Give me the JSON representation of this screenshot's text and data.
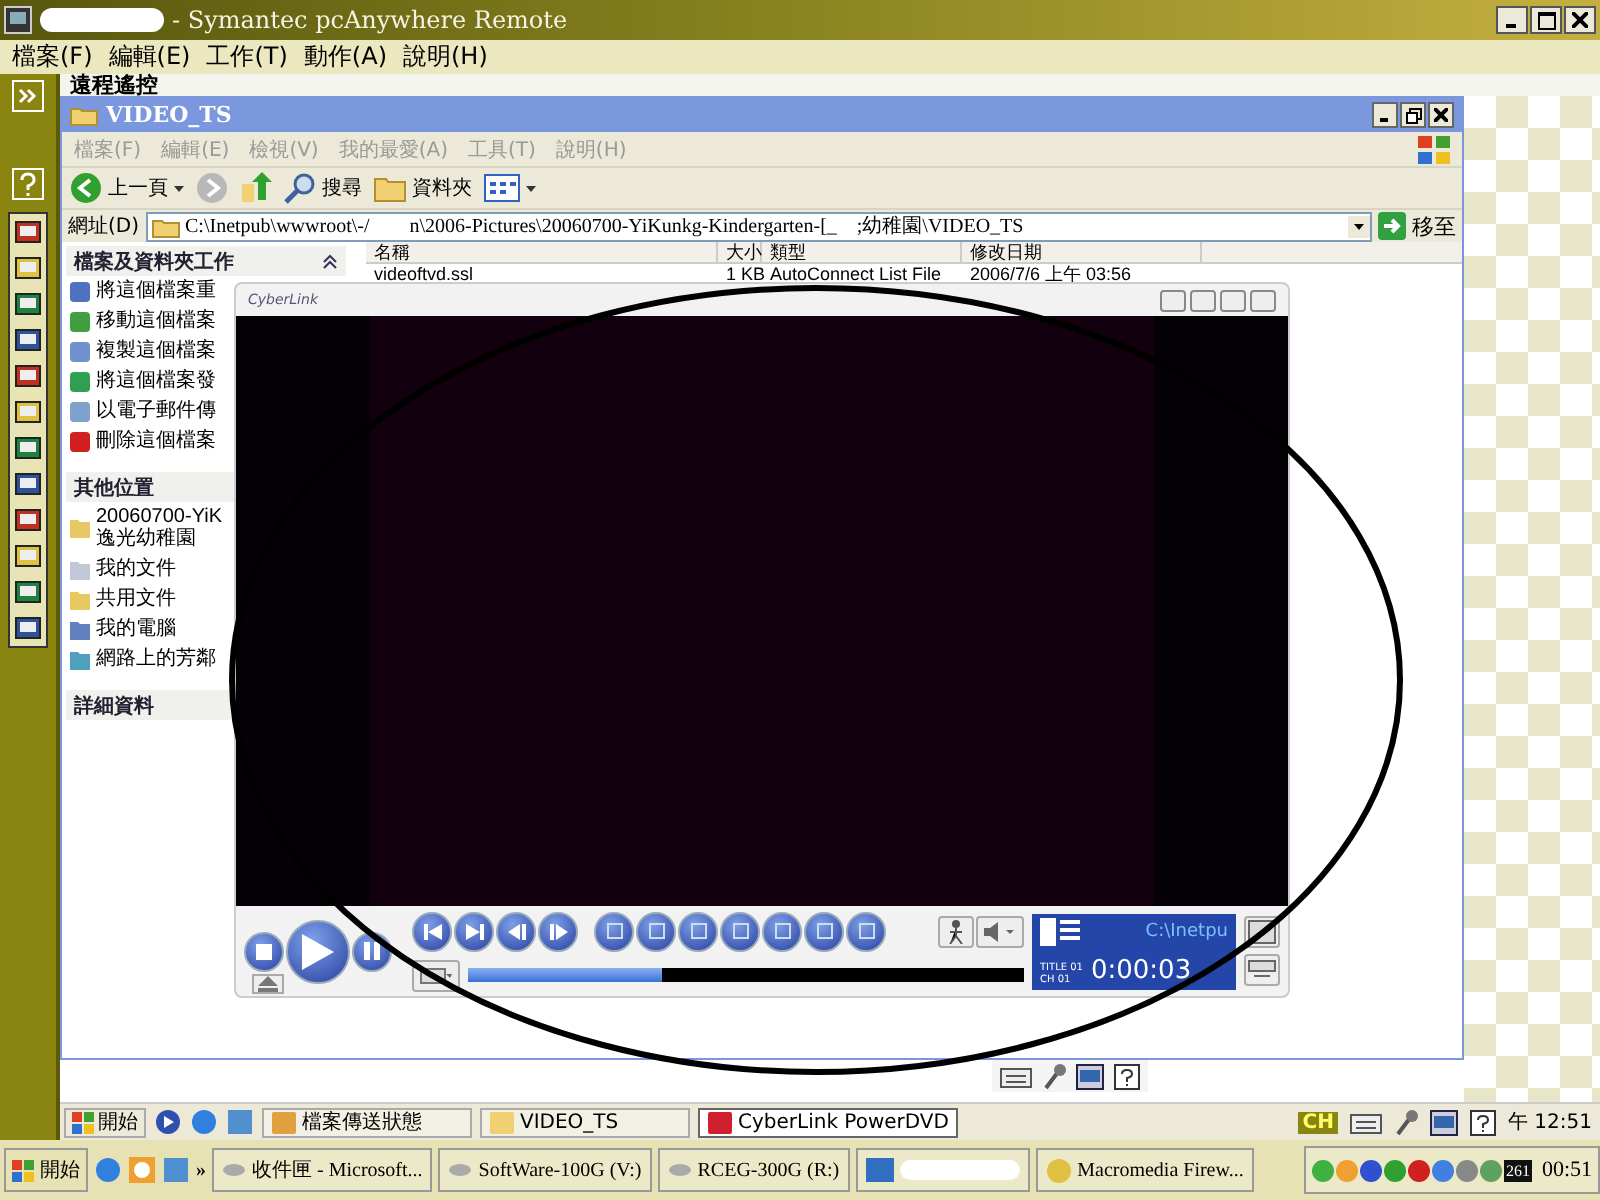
{
  "window": {
    "title": "- Symantec pcAnywhere Remote"
  },
  "menu": [
    "檔案(F)",
    "編輯(E)",
    "工作(T)",
    "動作(A)",
    "說明(H)"
  ],
  "remote_header": "遠程遙控",
  "explorer": {
    "title": "VIDEO_TS",
    "menu": [
      "檔案(F)",
      "編輯(E)",
      "檢視(V)",
      "我的最愛(A)",
      "工具(T)",
      "說明(H)"
    ],
    "toolbar": [
      "上一頁",
      "搜尋",
      "資料夾"
    ],
    "address_label": "網址(D)",
    "address": "C:\\Inetpub\\wwwroot\\-/        n\\2006-Pictures\\20060700-YiKunkg-Kindergarten-[_    ;幼稚園\\VIDEO_TS",
    "go": "移至",
    "tasks": {
      "title": "檔案及資料夾工作",
      "items": [
        "將這個檔案重",
        "移動這個檔案",
        "複製這個檔案",
        "將這個檔案發",
        "以電子郵件傳",
        "刪除這個檔案"
      ]
    },
    "places": {
      "title": "其他位置",
      "items": [
        "20060700-YiK\n逸光幼稚園",
        "我的文件",
        "共用文件",
        "我的電腦",
        "網路上的芳鄰"
      ]
    },
    "details": {
      "title": "詳細資料"
    },
    "columns": [
      "名稱",
      "大小",
      "類型",
      "修改日期"
    ],
    "rows": [
      [
        "videoftvd.ssl",
        "1 KB",
        "AutoConnect List File",
        "2006/7/6 上午 03:56"
      ]
    ]
  },
  "player": {
    "logo": "CyberLink",
    "path": "C:\\Inetpu",
    "title_no": "TITLE 01",
    "chapter_no": "CH 01",
    "time": "0:00:03",
    "progress": {
      "level": 0.35
    }
  },
  "inner_taskbar": {
    "start": "開始",
    "tasks": [
      {
        "label": "檔案傳送狀態",
        "selected": false
      },
      {
        "label": "VIDEO_TS",
        "selected": false
      },
      {
        "label": "CyberLink PowerDVD",
        "selected": true
      }
    ],
    "ime": "CH",
    "clock": "午 12:51"
  },
  "taskbar": {
    "start": "開始",
    "more": "»",
    "tasks": [
      {
        "label": "收件匣 - Microsoft...",
        "selected": false
      },
      {
        "label": "SoftWare-100G (V:)",
        "selected": false
      },
      {
        "label": "RCEG-300G (R:)",
        "selected": false
      },
      {
        "label": "Macromedia Firew...",
        "selected": false
      }
    ],
    "tray_badge": "261",
    "clock": "00:51"
  }
}
